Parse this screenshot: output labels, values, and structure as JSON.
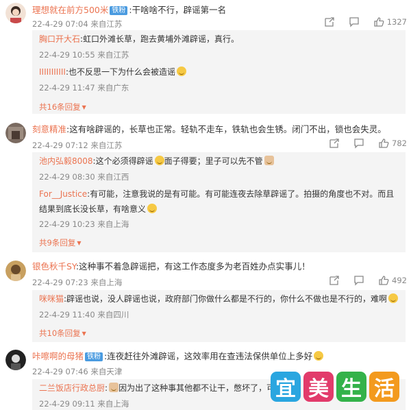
{
  "colors": {
    "username": "#eb7350",
    "badge": "#4a9be0",
    "meta": "#888888",
    "reply_bg": "#f4f4f4"
  },
  "comments": [
    {
      "username": "理想就在前方500米",
      "badge": "铁粉",
      "text": ":干啥啥不行，辟谣第一名",
      "time": "22-4-29 07:04 来自江苏",
      "likes": "1327",
      "replies": [
        {
          "username": "胸口开大石",
          "text": ":虹口外滩长草，跑去黄埔外滩辟谣，真行。",
          "time": "22-4-29 10:55 来自江苏"
        },
        {
          "username": "IIIIIIIIIII",
          "text": ":也不反思一下为什么会被造谣",
          "time": "22-4-29 11:47 来自广东"
        }
      ],
      "more": "共16条回复"
    },
    {
      "username": "刻意精准",
      "badge": "",
      "text": ":这有啥辟谣的，长草也正常。轻轨不走车，铁轨也会生锈。闭门不出，锁也会失灵。",
      "time": "22-4-29 07:12 来自江苏",
      "likes": "782",
      "replies": [
        {
          "username": "池内弘毅8008",
          "text": ":这个必须得辟谣",
          "text2": "面子得要；里子可以先不管",
          "time": "22-4-29 08:30 来自江西"
        },
        {
          "username": "For__Justice",
          "text": ":有可能，注意我说的是有可能。有可能连夜去除草辟谣了。拍摄的角度也不对。而且结果到底长没长草，有啥意义",
          "time": "22-4-29 10:23 来自上海"
        }
      ],
      "more": "共9条回复"
    },
    {
      "username": "银色秋千SY",
      "badge": "",
      "text": ":这种事不着急辟谣把，有这工作态度多为老百姓办点实事儿！",
      "time": "22-4-29 07:23 来自上海",
      "likes": "492",
      "replies": [
        {
          "username": "咪咪猫",
          "text": ":辟谣也说，没人辟谣也说，政府部门你做什么都是不行的，你什么不做也是不行的，难啊",
          "time": "22-4-29 11:40 来自四川"
        }
      ],
      "more": "共10条回复"
    },
    {
      "username": "咔嚓啊的母猪",
      "badge": "铁粉",
      "text": ":连夜赶往外滩辟谣，这效率用在查违法保供单位上多好",
      "time": "22-4-29 07:46 来自天津",
      "likes": "",
      "replies": [
        {
          "username": "二兰饭店行政总厨",
          "text": ":",
          "text2": "因为出了这种事其他都不让干，憋坏了，可",
          "time": "22-4-29 09:11 来自上海"
        }
      ],
      "more": ""
    }
  ],
  "watermark": {
    "chars": [
      "宜",
      "美",
      "生",
      "活"
    ],
    "colors": [
      "#2aa6e0",
      "#e23b6b",
      "#34b24a",
      "#f39a1e"
    ]
  }
}
